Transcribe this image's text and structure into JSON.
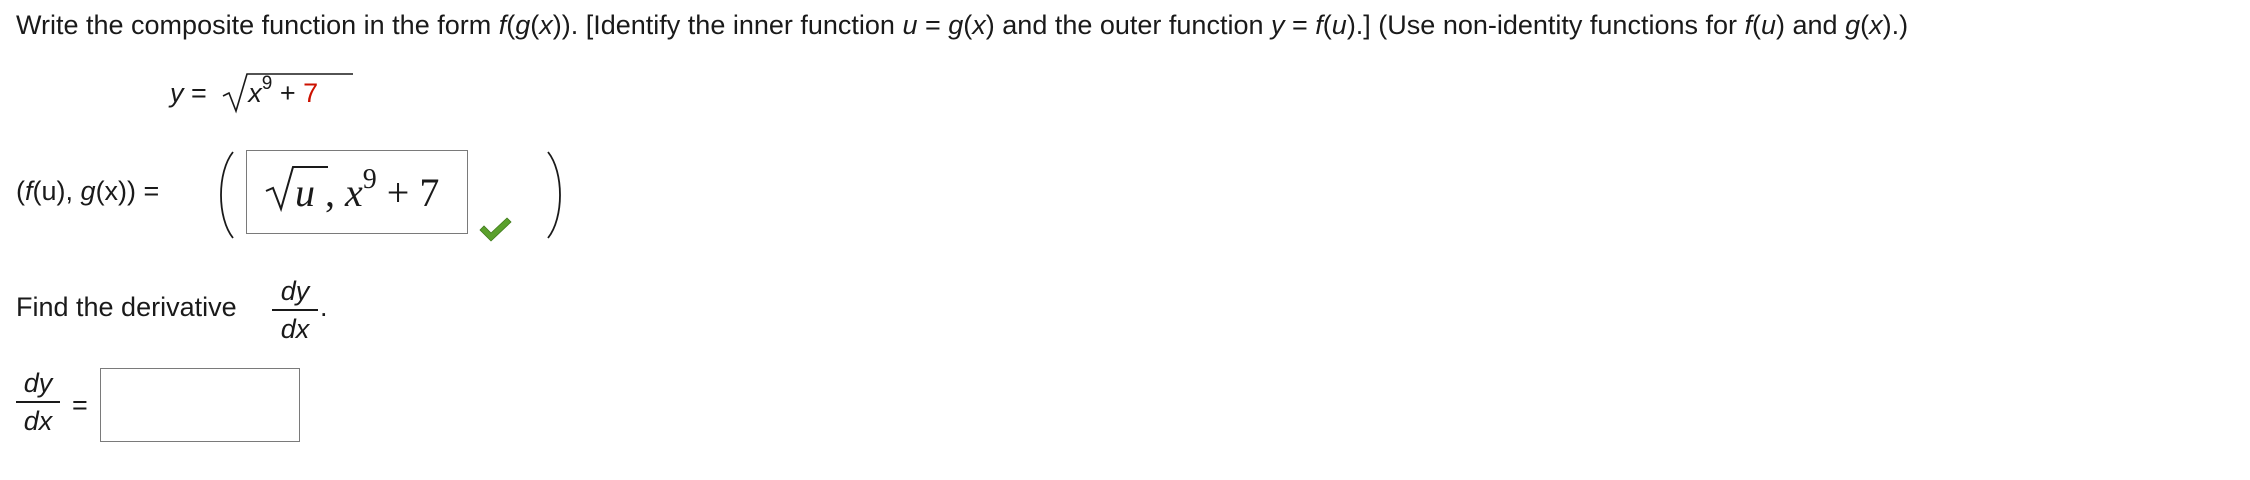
{
  "instruction": {
    "p1": "Write the composite function in the form ",
    "p2": "f",
    "p3": "(",
    "p4": "g",
    "p5": "(",
    "p6": "x",
    "p7": ")). [Identify the inner function ",
    "p8": "u",
    "p9": " = ",
    "p10": "g",
    "p11": "(",
    "p12": "x",
    "p13": ") and the outer function ",
    "p14": "y",
    "p15": " = ",
    "p16": "f",
    "p17": "(",
    "p18": "u",
    "p19": ").] (Use non-identity functions for ",
    "p20": "f",
    "p21": "(",
    "p22": "u",
    "p23": ") and ",
    "p24": "g",
    "p25": "(",
    "p26": "x",
    "p27": ").)"
  },
  "equation": {
    "lhs": "y",
    "equals": " = ",
    "base": "x",
    "exponent": "9",
    "plus": " + ",
    "constant": "7"
  },
  "pair": {
    "label_open": "(",
    "f_name": "f",
    "f_arg": "(u)",
    "comma": ", ",
    "g_name": "g",
    "g_arg": "(x)",
    "label_close": ") =",
    "answer": {
      "f_radicand": "u",
      "separator": " , ",
      "g_base": "x",
      "g_exponent": "9",
      "g_rest": " + 7"
    },
    "status_icon": "check-icon",
    "status_color": "#5aa02c"
  },
  "derivative": {
    "prompt": "Find the derivative ",
    "numerator": "dy",
    "denominator": "dx",
    "period": ".",
    "lhs_numerator": "dy",
    "lhs_denominator": "dx",
    "equals": "=",
    "input_value": ""
  }
}
